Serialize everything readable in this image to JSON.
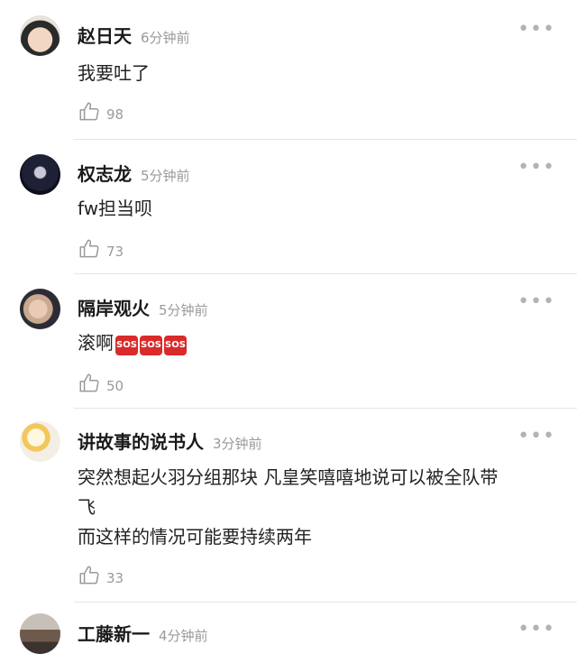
{
  "comments": [
    {
      "name": "赵日天",
      "time": "6分钟前",
      "text": "我要吐了",
      "likes": "98"
    },
    {
      "name": "权志龙",
      "time": "5分钟前",
      "text": "fw担当呗",
      "likes": "73"
    },
    {
      "name": "隔岸观火",
      "time": "5分钟前",
      "text": "滚啊",
      "emoji": [
        "SOS",
        "SOS",
        "SOS"
      ],
      "likes": "50"
    },
    {
      "name": "讲故事的说书人",
      "time": "3分钟前",
      "text_lines": [
        "突然想起火羽分组那块 凡皇笑嘻嘻地说可以被全队带",
        "飞",
        "而这样的情况可能要持续两年"
      ],
      "likes": "33"
    },
    {
      "name": "工藤新一",
      "time": "4分钟前"
    }
  ],
  "icons": {
    "more": "more-dots-icon",
    "like": "thumbs-up-icon"
  }
}
